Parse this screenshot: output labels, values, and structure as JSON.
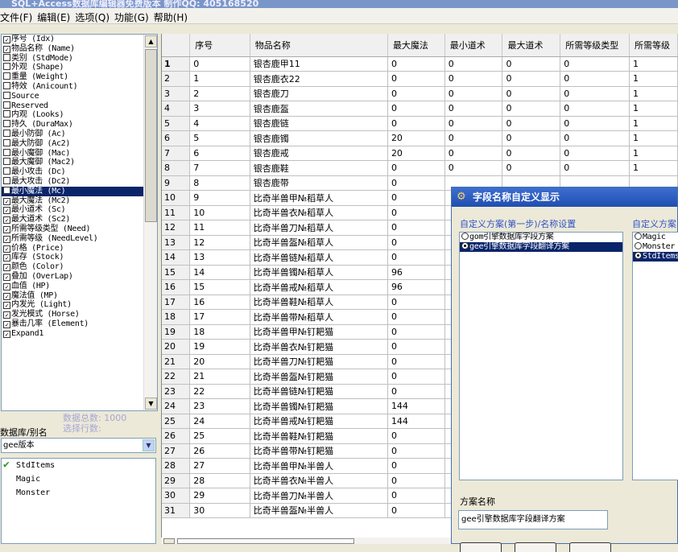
{
  "window_title": "SQL+Access数据库编辑器免费版本  制作QQ: 405168520",
  "menu": [
    "文件(F)",
    "编辑(E)",
    "选项(Q)",
    "功能(G)",
    "帮助(H)"
  ],
  "fields": [
    {
      "label": "序号 (Idx)",
      "checked": true
    },
    {
      "label": "物品名称 (Name)",
      "checked": true
    },
    {
      "label": "类别 (StdMode)",
      "checked": false
    },
    {
      "label": "外观 (Shape)",
      "checked": false
    },
    {
      "label": "重量 (Weight)",
      "checked": false
    },
    {
      "label": "特效 (Anicount)",
      "checked": false
    },
    {
      "label": "Source",
      "checked": false
    },
    {
      "label": "Reserved",
      "checked": false
    },
    {
      "label": "内观 (Looks)",
      "checked": false
    },
    {
      "label": "持久 (DuraMax)",
      "checked": false
    },
    {
      "label": "最小防御 (Ac)",
      "checked": false
    },
    {
      "label": "最大防御 (Ac2)",
      "checked": false
    },
    {
      "label": "最小魔御 (Mac)",
      "checked": false
    },
    {
      "label": "最大魔御 (Mac2)",
      "checked": false
    },
    {
      "label": "最小攻击 (Dc)",
      "checked": false
    },
    {
      "label": "最大攻击 (Dc2)",
      "checked": false
    },
    {
      "label": "最小魔法 (Mc)",
      "checked": false,
      "selected": true
    },
    {
      "label": "最大魔法 (Mc2)",
      "checked": true
    },
    {
      "label": "最小道术 (Sc)",
      "checked": true
    },
    {
      "label": "最大道术 (Sc2)",
      "checked": true
    },
    {
      "label": "所需等级类型 (Need)",
      "checked": true
    },
    {
      "label": "所需等级 (NeedLevel)",
      "checked": true
    },
    {
      "label": "价格 (Price)",
      "checked": true
    },
    {
      "label": "库存 (Stock)",
      "checked": true
    },
    {
      "label": "颜色 (Color)",
      "checked": true
    },
    {
      "label": "叠加 (OverLap)",
      "checked": true
    },
    {
      "label": "血值 (HP)",
      "checked": true
    },
    {
      "label": "魔法值 (MP)",
      "checked": true
    },
    {
      "label": "内发光 (Light)",
      "checked": true
    },
    {
      "label": "发光模式 (Horse)",
      "checked": true
    },
    {
      "label": "暴击几率 (Element)",
      "checked": true
    },
    {
      "label": "Expand1",
      "checked": true
    }
  ],
  "total_label": "数据总数: 1000",
  "selected_rows_label": "选择行数:",
  "alias_label": "数据库/别名",
  "db_select": "gee版本",
  "tables": [
    {
      "name": "StdItems",
      "checked": true
    },
    {
      "name": "Magic",
      "checked": false
    },
    {
      "name": "Monster",
      "checked": false
    }
  ],
  "grid": {
    "columns": [
      "序号",
      "物品名称",
      "最大魔法",
      "最小道术",
      "最大道术",
      "所需等级类型",
      "所需等级"
    ],
    "rows": [
      [
        "1",
        "0",
        "银杏鹿甲11",
        "0",
        "0",
        "0",
        "0",
        "1"
      ],
      [
        "2",
        "1",
        "银杏鹿衣22",
        "0",
        "0",
        "0",
        "0",
        "1"
      ],
      [
        "3",
        "2",
        "银杏鹿刀",
        "0",
        "0",
        "0",
        "0",
        "1"
      ],
      [
        "4",
        "3",
        "银杏鹿盔",
        "0",
        "0",
        "0",
        "0",
        "1"
      ],
      [
        "5",
        "4",
        "银杏鹿链",
        "0",
        "0",
        "0",
        "0",
        "1"
      ],
      [
        "6",
        "5",
        "银杏鹿镯",
        "20",
        "0",
        "0",
        "0",
        "1"
      ],
      [
        "7",
        "6",
        "银杏鹿戒",
        "20",
        "0",
        "0",
        "0",
        "1"
      ],
      [
        "8",
        "7",
        "银杏鹿鞋",
        "0",
        "0",
        "0",
        "0",
        "1"
      ],
      [
        "9",
        "8",
        "银杏鹿带",
        "0",
        "",
        "",
        "",
        ""
      ],
      [
        "10",
        "9",
        "比奇半兽甲№稻草人",
        "0",
        "",
        "",
        "",
        ""
      ],
      [
        "11",
        "10",
        "比奇半兽衣№稻草人",
        "0",
        "",
        "",
        "",
        ""
      ],
      [
        "12",
        "11",
        "比奇半兽刀№稻草人",
        "0",
        "",
        "",
        "",
        ""
      ],
      [
        "13",
        "12",
        "比奇半兽盔№稻草人",
        "0",
        "",
        "",
        "",
        ""
      ],
      [
        "14",
        "13",
        "比奇半兽链№稻草人",
        "0",
        "",
        "",
        "",
        ""
      ],
      [
        "15",
        "14",
        "比奇半兽镯№稻草人",
        "96",
        "",
        "",
        "",
        ""
      ],
      [
        "16",
        "15",
        "比奇半兽戒№稻草人",
        "96",
        "",
        "",
        "",
        ""
      ],
      [
        "17",
        "16",
        "比奇半兽鞋№稻草人",
        "0",
        "",
        "",
        "",
        ""
      ],
      [
        "18",
        "17",
        "比奇半兽带№稻草人",
        "0",
        "",
        "",
        "",
        ""
      ],
      [
        "19",
        "18",
        "比奇半兽甲№钉耙猫",
        "0",
        "",
        "",
        "",
        ""
      ],
      [
        "20",
        "19",
        "比奇半兽衣№钉耙猫",
        "0",
        "",
        "",
        "",
        ""
      ],
      [
        "21",
        "20",
        "比奇半兽刀№钉耙猫",
        "0",
        "",
        "",
        "",
        ""
      ],
      [
        "22",
        "21",
        "比奇半兽盔№钉耙猫",
        "0",
        "",
        "",
        "",
        ""
      ],
      [
        "23",
        "22",
        "比奇半兽链№钉耙猫",
        "0",
        "",
        "",
        "",
        ""
      ],
      [
        "24",
        "23",
        "比奇半兽镯№钉耙猫",
        "144",
        "",
        "",
        "",
        ""
      ],
      [
        "25",
        "24",
        "比奇半兽戒№钉耙猫",
        "144",
        "",
        "",
        "",
        ""
      ],
      [
        "26",
        "25",
        "比奇半兽鞋№钉耙猫",
        "0",
        "",
        "",
        "",
        ""
      ],
      [
        "27",
        "26",
        "比奇半兽带№钉耙猫",
        "0",
        "",
        "",
        "",
        ""
      ],
      [
        "28",
        "27",
        "比奇半兽甲№半兽人",
        "0",
        "",
        "",
        "",
        ""
      ],
      [
        "29",
        "28",
        "比奇半兽衣№半兽人",
        "0",
        "",
        "",
        "",
        ""
      ],
      [
        "30",
        "29",
        "比奇半兽刀№半兽人",
        "0",
        "",
        "",
        "",
        ""
      ],
      [
        "31",
        "30",
        "比奇半兽盔№半兽人",
        "0",
        "",
        "",
        "",
        ""
      ]
    ]
  },
  "dialog": {
    "title": "字段名称自定义显示",
    "scheme_label": "自定义方案(第一步)/名称设置",
    "scheme_label2": "自定义方案",
    "schemes": [
      {
        "label": "gom引擎数据库字段方案",
        "selected": false
      },
      {
        "label": "gee引擎数据库字段翻译方案",
        "selected": true
      }
    ],
    "tables2": [
      {
        "label": "Magic",
        "selected": false
      },
      {
        "label": "Monster",
        "selected": false
      },
      {
        "label": "StdItems",
        "selected": true
      }
    ],
    "scheme_name_label": "方案名称",
    "scheme_name": "gee引擎数据库字段翻译方案"
  }
}
